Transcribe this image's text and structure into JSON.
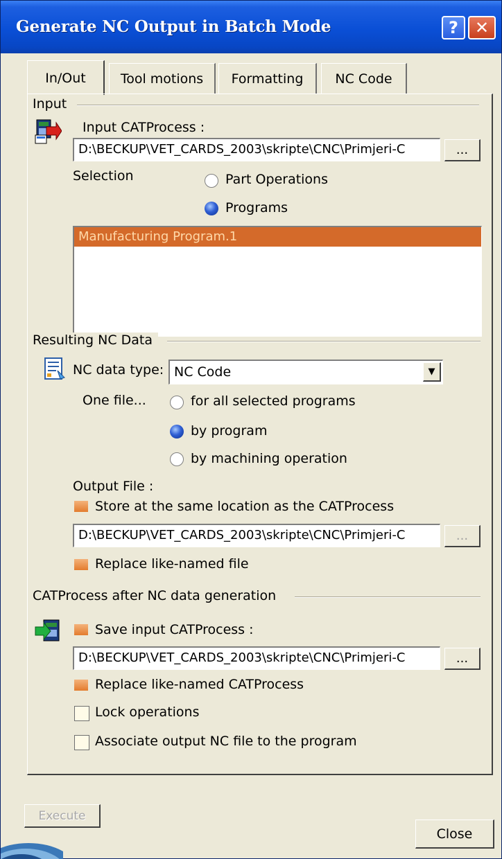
{
  "window": {
    "title": "Generate NC Output in Batch Mode",
    "help_label": "?",
    "close_label": "✕"
  },
  "tabs": [
    {
      "label": "In/Out",
      "active": true
    },
    {
      "label": "Tool motions",
      "active": false
    },
    {
      "label": "Formatting",
      "active": false
    },
    {
      "label": "NC Code",
      "active": false
    }
  ],
  "input": {
    "section_title": "Input",
    "catprocess_label": "Input CATProcess :",
    "catprocess_path": "D:\\BECKUP\\VET_CARDS_2003\\skripte\\CNC\\Primjeri-C",
    "browse_label": "...",
    "selection_label": "Selection",
    "option_part_operations": "Part Operations",
    "option_programs": "Programs",
    "selected_option": "Programs",
    "program_list": [
      "Manufacturing Program.1"
    ]
  },
  "resulting": {
    "section_title": "Resulting NC Data",
    "nc_data_type_label": "NC data type:",
    "nc_data_type_value": "NC Code",
    "one_file_label": "One file...",
    "option_all_programs": "for all selected programs",
    "option_by_program": "by program",
    "option_by_operation": "by machining operation",
    "selected_option": "by program",
    "output_file_label": "Output File :",
    "store_same_location_label": "Store at the same location as the CATProcess",
    "store_same_location_checked": true,
    "output_path": "D:\\BECKUP\\VET_CARDS_2003\\skripte\\CNC\\Primjeri-C",
    "browse_label": "...",
    "replace_file_label": "Replace like-named file",
    "replace_file_checked": true
  },
  "after": {
    "section_title": "CATProcess after NC data generation",
    "save_input_label": "Save input CATProcess :",
    "save_input_checked": true,
    "save_path": "D:\\BECKUP\\VET_CARDS_2003\\skripte\\CNC\\Primjeri-C",
    "browse_label": "...",
    "replace_catprocess_label": "Replace like-named CATProcess",
    "replace_catprocess_checked": true,
    "lock_operations_label": "Lock operations",
    "lock_operations_checked": false,
    "associate_label": "Associate output NC file to the program",
    "associate_checked": false
  },
  "footer": {
    "execute_label": "Execute",
    "close_label": "Close"
  },
  "colors": {
    "titlebar": "#0a4fd6",
    "dialog_bg": "#ece9d8",
    "selection_bg": "#d46a2a",
    "checkbox_orange": "#e37c2e"
  }
}
